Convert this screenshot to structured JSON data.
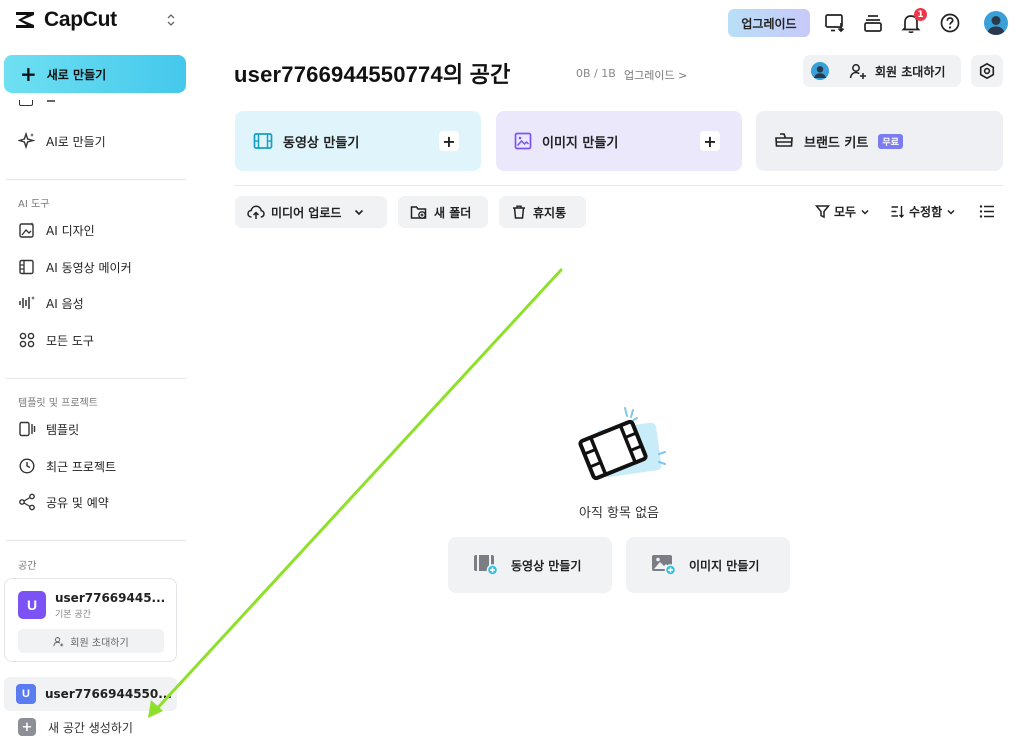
{
  "app": {
    "name": "CapCut"
  },
  "sidebar": {
    "new_button": "새로 만들기",
    "partial_item": "ㄷ",
    "ai_create": "AI로 만들기",
    "section_ai_tools": "AI 도구",
    "ai_tools": [
      {
        "label": "AI 디자인",
        "icon": "ai-design-icon"
      },
      {
        "label": "AI 동영상 메이커",
        "icon": "ai-video-maker-icon"
      },
      {
        "label": "AI 음성",
        "icon": "ai-voice-icon"
      },
      {
        "label": "모든 도구",
        "icon": "all-tools-icon"
      }
    ],
    "section_templates": "템플릿 및 프로젝트",
    "template_items": [
      {
        "label": "템플릿",
        "icon": "template-icon"
      },
      {
        "label": "최근 프로젝트",
        "icon": "clock-icon"
      },
      {
        "label": "공유 및 예약",
        "icon": "share-icon"
      }
    ],
    "section_space": "공간",
    "space_card": {
      "avatar_letter": "U",
      "name": "user77669445...",
      "subtitle": "기본 공간",
      "invite": "회원 초대하기"
    },
    "space_row": {
      "avatar_letter": "U",
      "name": "user7766944550..."
    },
    "create_space": "새 공간 생성하기"
  },
  "topbar": {
    "upgrade": "업그레이드",
    "notification_count": "1"
  },
  "header": {
    "title": "user7766944550774의 공간",
    "storage": "0B / 1B",
    "storage_upgrade": "업그레이드 >",
    "invite_members": "회원 초대하기"
  },
  "create_cards": [
    {
      "label": "동영상 만들기",
      "color": "#dff5fb"
    },
    {
      "label": "이미지 만들기",
      "color": "#ece8fb"
    },
    {
      "label": "브랜드 키트",
      "badge": "무료",
      "color": "#eef0f3"
    }
  ],
  "toolbar": {
    "upload": "미디어 업로드",
    "new_folder": "새 폴더",
    "trash": "휴지통",
    "filter": "모두",
    "sort": "수정함"
  },
  "empty_state": {
    "message": "아직 항목 없음",
    "video_button": "동영상 만들기",
    "image_button": "이미지 만들기"
  },
  "colors": {
    "accent": "#44c8ec",
    "annotation_arrow": "#8ee02a",
    "badge": "#f0364b"
  }
}
